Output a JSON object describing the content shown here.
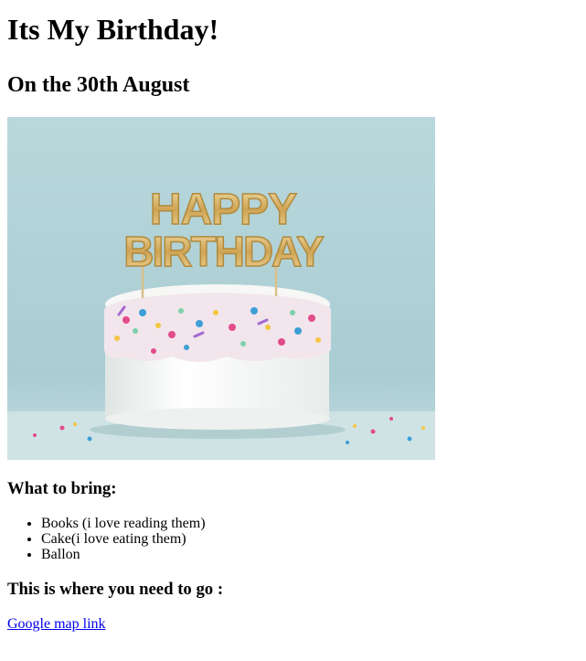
{
  "heading": "Its My Birthday!",
  "subheading": "On the 30th August",
  "image": {
    "subject": "cake-with-happy-birthday-topper",
    "topper_text": "HAPPY BIRTHDAY",
    "colors": {
      "background": "#b7d6db",
      "gold": "#d9b46a",
      "icing": "#f3f4f2"
    }
  },
  "bring": {
    "title": "What to bring:",
    "items": [
      "Books (i love reading them)",
      "Cake(i love eating them)",
      "Ballon"
    ]
  },
  "location": {
    "title": "This is where you need to go :",
    "link_text": "Google map link"
  }
}
